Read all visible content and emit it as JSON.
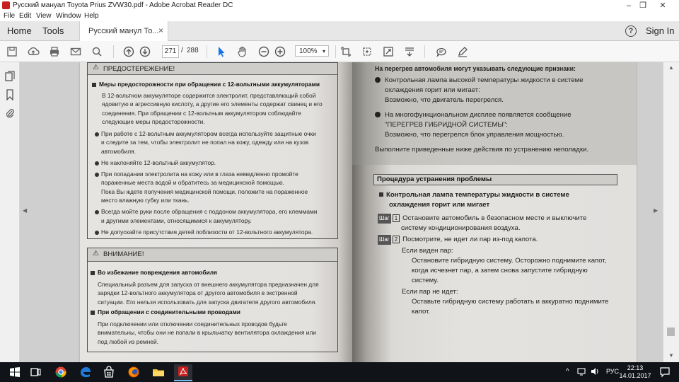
{
  "window": {
    "title": "Русский мануал Toyota Prius ZVW30.pdf - Adobe Acrobat Reader DC",
    "controls": [
      "–",
      "❐",
      "✕"
    ]
  },
  "menu": [
    "File",
    "Edit",
    "View",
    "Window",
    "Help"
  ],
  "tabs": {
    "home": "Home",
    "tools": "Tools",
    "document": "Русский манул То...",
    "close": "×",
    "help": "?",
    "signin": "Sign In"
  },
  "toolbar": {
    "page_current": "271",
    "page_sep": "/",
    "page_total": "288",
    "zoom": "100%",
    "zoom_caret": "▾"
  },
  "left_page": {
    "warning_header": "ПРЕДОСТЕРЕЖЕНИЕ!",
    "warning_title": "Меры предосторожности при обращении с 12-вольтными аккумуляторами",
    "warning_intro": [
      "В 12-вольтном аккумуляторе содержится электролит, представляющий собой",
      "ядовитую и агрессивную кислоту, а другие его элементы содержат свинец и его",
      "соединения. При обращении с 12-вольтным аккумулятором соблюдайте",
      "следующие меры предосторожности."
    ],
    "warning_bullets": [
      [
        "При работе с 12-вольтным аккумулятором всегда используйте защитные очки",
        "и следите за тем, чтобы электролит не попал на кожу, одежду или на кузов",
        "автомобиля."
      ],
      [
        "Не наклоняйте 12-вольтный аккумулятор."
      ],
      [
        "При попадании электролита на кожу или в глаза немедленно промойте",
        "пораженные места водой и обратитесь за медицинской помощью.",
        "Пока Вы ждете получения медицинской помощи, положите на пораженное",
        "место влажную губку или ткань."
      ],
      [
        "Всегда мойте руки после обращения с поддоном аккумулятора, его клеммами",
        "и другими элементами, относящимися к аккумулятору."
      ],
      [
        "Не допускайте присутствия детей поблизости от 12-вольтного аккумулятора."
      ]
    ],
    "notice_header": "ВНИМАНИЕ!",
    "notice_title1": "Во избежание повреждения автомобиля",
    "notice_text1": [
      "Специальный разъем для запуска от внешнего аккумулятора предназначен для",
      "зарядки 12-вольтного аккумулятора от другого автомобиля в экстренной",
      "ситуации. Его нельзя использовать для запуска двигателя другого автомобиля."
    ],
    "notice_title2": "При обращении с соединительными проводами",
    "notice_text2": [
      "При подключении или отключении соединительных проводов будьте",
      "внимательны, чтобы они не попали в крыльчатку вентилятора охлаждения или",
      "под любой из ремней."
    ]
  },
  "right_page": {
    "intro": "На перегрев автомобиля могут указывать следующие признаки:",
    "signs": [
      {
        "text": [
          "Контрольная лампа высокой температуры жидкости в системе",
          "охлаждения горит или мигает:"
        ],
        "detail": "Возможно, что двигатель перегрелся."
      },
      {
        "text": [
          "На многофункциональном дисплее появляется сообщение",
          "\"ПЕРЕГРЕВ ГИБРИДНОЙ СИСТЕМЫ\":"
        ],
        "detail": "Возможно, что перегрелся блок управления мощностью."
      }
    ],
    "action": "Выполните приведенные ниже действия по устранению неполадки.",
    "procedure_title": "Процедура устранения проблемы",
    "subtitle": [
      "Контрольная лампа температуры жидкости в системе",
      "охлаждения горит или мигает"
    ],
    "step_word": "Шаг",
    "step1_num": "1",
    "step1": [
      "Остановите автомобиль в безопасном месте и выключите",
      "систему кондиционирования воздуха."
    ],
    "step2_num": "2",
    "step2": "Посмотрите, не идет ли пар из-под капота.",
    "if_steam": "Если виден пар:",
    "if_steam_text": [
      "Остановите гибридную систему. Осторожно поднимите капот,",
      "когда исчезнет пар, а затем снова запустите гибридную",
      "систему."
    ],
    "if_no_steam": "Если пар не идет:",
    "if_no_steam_text": [
      "Оставьте гибридную систему работать и аккуратно поднимите",
      "капот."
    ]
  },
  "taskbar": {
    "lang": "РУС",
    "time": "22:13",
    "date": "14.01.2017"
  },
  "colors": {
    "acrobat_red": "#c8201f",
    "select_blue": "#1473e6",
    "taskbar": "#101418"
  }
}
